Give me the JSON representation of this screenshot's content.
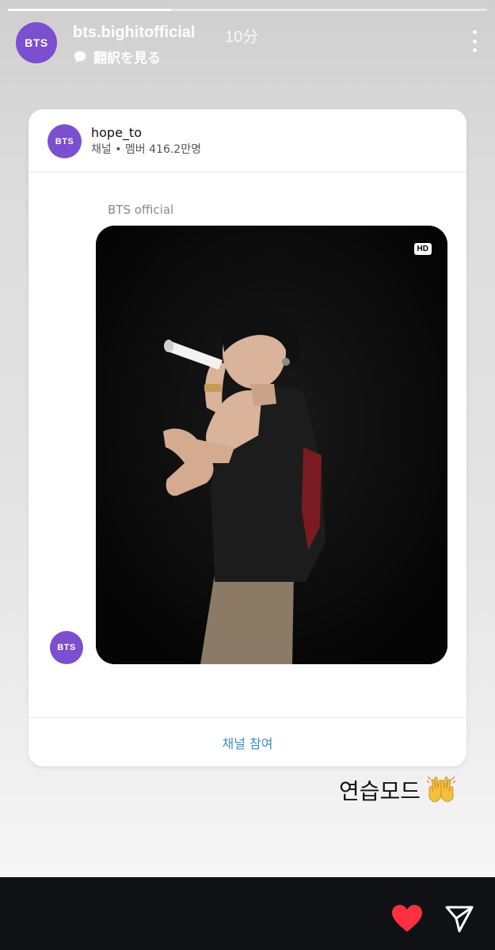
{
  "header": {
    "username": "bts.bighitofficial",
    "time": "10分",
    "translate_label": "翻訳を見る",
    "avatar_text": "BTS"
  },
  "card": {
    "channel_name": "hope_to",
    "channel_meta": "채널 • 멤버 416.2만명",
    "avatar_text": "BTS",
    "sender_name": "BTS official",
    "hd_badge": "HD",
    "join_label": "채널 참여"
  },
  "caption": {
    "text": "연습모드",
    "emoji": "raising-hands-emoji"
  },
  "story_progress": 0.34,
  "colors": {
    "accent": "#7b4fcf",
    "link": "#3d8fc4",
    "like": "#ff3040",
    "bottom_bar": "#0f1114"
  }
}
